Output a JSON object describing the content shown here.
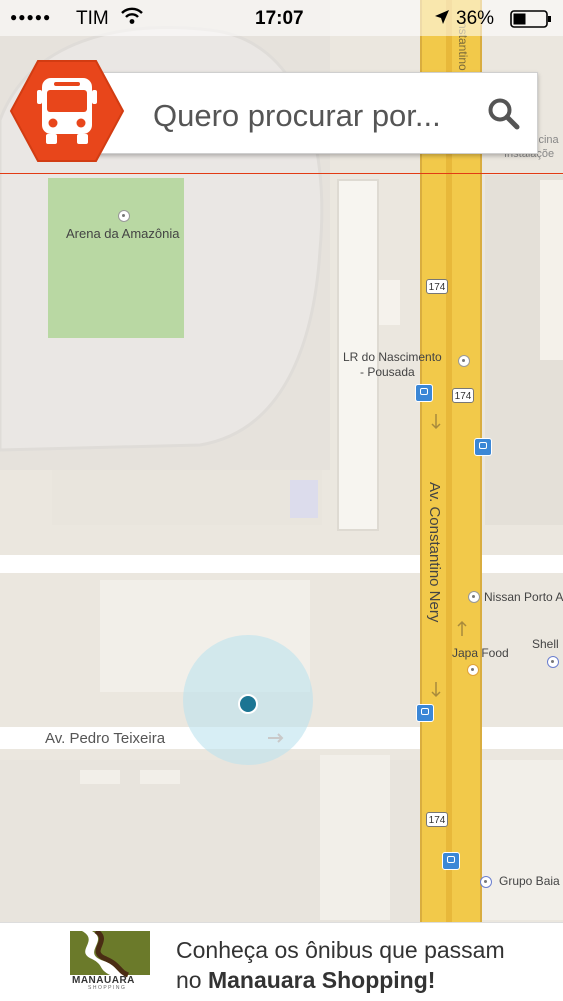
{
  "status_bar": {
    "carrier": "TIM",
    "time": "17:07",
    "battery": "36%"
  },
  "search": {
    "placeholder": "Quero procurar por..."
  },
  "map": {
    "labels": {
      "stadium": "Arena da Amazônia",
      "pousada_line1": "LR do Nascimento",
      "pousada_line2": "- Pousada",
      "avenue_vertical": "Av. Constantino Nery",
      "avenue_horizontal": "Av. Pedro Teixeira",
      "nissan": "Nissan Porto A",
      "japa": "Japa Food",
      "shell": "Shell",
      "grupo": "Grupo Baia",
      "top_right_1": "icina",
      "top_right_2": "Instalaçõe",
      "top_road": "nstantino"
    },
    "route_shield": "174"
  },
  "banner": {
    "line1": "Conheça os ônibus que passam",
    "line2_prefix": "no ",
    "line2_bold": "Manauara Shopping!",
    "logo_text": "MANAUARA",
    "logo_sub": "SHOPPING"
  },
  "colors": {
    "accent": "#e8461b",
    "road_yellow": "#f2c94a",
    "location": "#1b7593"
  }
}
